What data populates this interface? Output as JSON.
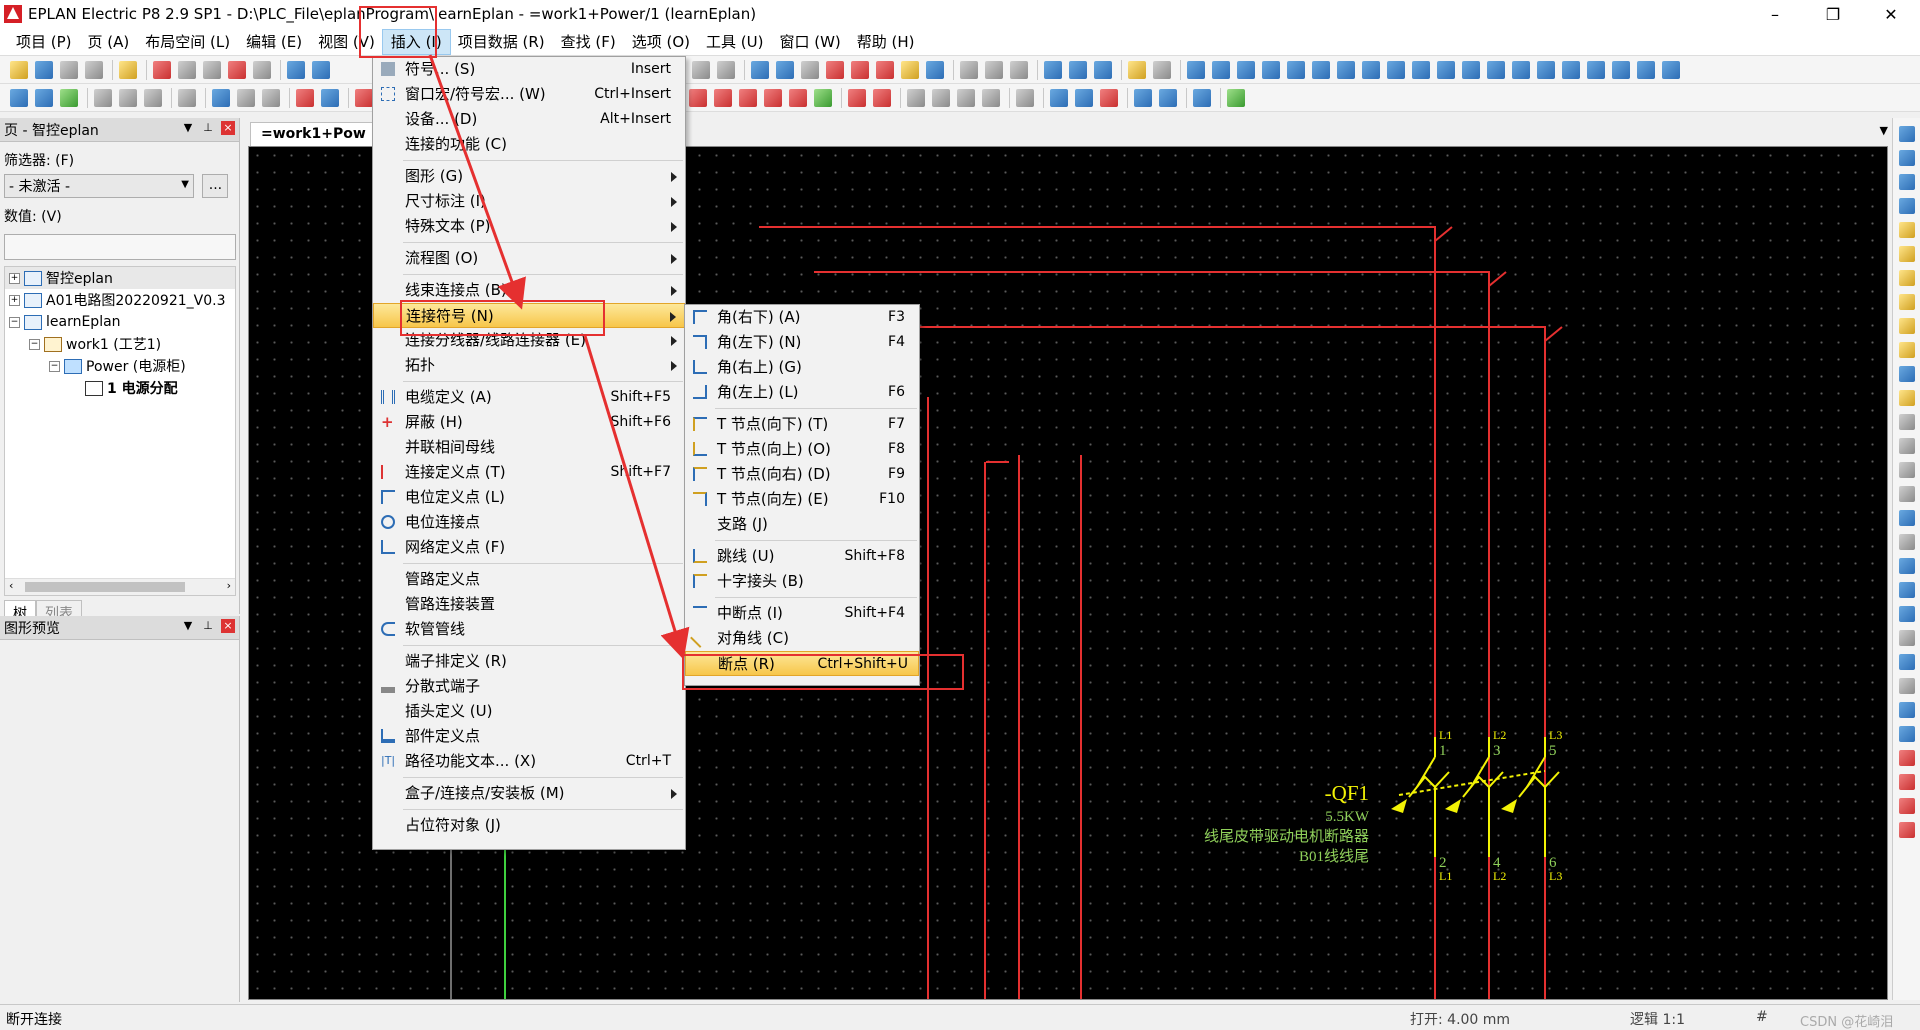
{
  "window": {
    "title": "EPLAN Electric P8 2.9 SP1 - D:\\PLC_File\\eplanProgram\\learnEplan - =work1+Power/1 (learnEplan)",
    "minimize": "–",
    "maximize": "❐",
    "close": "✕"
  },
  "menubar": {
    "items": [
      "项目 (P)",
      "页 (A)",
      "布局空间 (L)",
      "编辑 (E)",
      "视图 (V)",
      "插入 (I)",
      "项目数据 (R)",
      "查找 (F)",
      "选项 (O)",
      "工具 (U)",
      "窗口 (W)",
      "帮助 (H)"
    ]
  },
  "page_panel": {
    "title": "页 - 智控eplan",
    "filter_label": "筛选器: (F)",
    "filter_value": "- 未激活 -",
    "dots_button": "...",
    "value_label": "数值: (V)",
    "tree": [
      {
        "label": "智控eplan",
        "expander": "+"
      },
      {
        "label": "A01电路图20220921_V0.3",
        "expander": "+"
      },
      {
        "label": "learnEplan",
        "expander": "−"
      },
      {
        "label": "work1 (工艺1)",
        "expander": "−"
      },
      {
        "label": "Power (电源柜)",
        "expander": "−"
      },
      {
        "label": "1 电源分配",
        "expander": ""
      }
    ],
    "tabs": [
      "树",
      "列表"
    ]
  },
  "preview_panel": {
    "title": "图形预览"
  },
  "document_tab": {
    "label": "=work1+Pow"
  },
  "insert_menu": {
    "items": [
      {
        "label": "符号... (S)",
        "shortcut": "Insert",
        "submenu": false
      },
      {
        "label": "窗口宏/符号宏... (W)",
        "shortcut": "Ctrl+Insert",
        "submenu": false
      },
      {
        "label": "设备... (D)",
        "shortcut": "Alt+Insert",
        "submenu": false
      },
      {
        "label": "连接的功能 (C)",
        "shortcut": "",
        "submenu": false
      },
      {
        "label": "图形 (G)",
        "shortcut": "",
        "submenu": true
      },
      {
        "label": "尺寸标注 (I)",
        "shortcut": "",
        "submenu": true
      },
      {
        "label": "特殊文本 (P)",
        "shortcut": "",
        "submenu": true
      },
      {
        "label": "流程图 (O)",
        "shortcut": "",
        "submenu": true
      },
      {
        "label": "线束连接点 (B)",
        "shortcut": "",
        "submenu": true
      },
      {
        "label": "连接符号 (N)",
        "shortcut": "",
        "submenu": true
      },
      {
        "label": "连接分线器/线路连接器 (E)",
        "shortcut": "",
        "submenu": true
      },
      {
        "label": "拓扑",
        "shortcut": "",
        "submenu": true
      },
      {
        "label": "电缆定义 (A)",
        "shortcut": "Shift+F5",
        "submenu": false
      },
      {
        "label": "屏蔽 (H)",
        "shortcut": "Shift+F6",
        "submenu": false
      },
      {
        "label": "并联相间母线",
        "shortcut": "",
        "submenu": false
      },
      {
        "label": "连接定义点 (T)",
        "shortcut": "Shift+F7",
        "submenu": false
      },
      {
        "label": "电位定义点 (L)",
        "shortcut": "",
        "submenu": false
      },
      {
        "label": "电位连接点",
        "shortcut": "",
        "submenu": false
      },
      {
        "label": "网络定义点 (F)",
        "shortcut": "",
        "submenu": false
      },
      {
        "label": "管路定义点",
        "shortcut": "",
        "submenu": false
      },
      {
        "label": "管路连接装置",
        "shortcut": "",
        "submenu": false
      },
      {
        "label": "软管管线",
        "shortcut": "",
        "submenu": false
      },
      {
        "label": "端子排定义 (R)",
        "shortcut": "",
        "submenu": false
      },
      {
        "label": "分散式端子",
        "shortcut": "",
        "submenu": false
      },
      {
        "label": "插头定义 (U)",
        "shortcut": "",
        "submenu": false
      },
      {
        "label": "部件定义点",
        "shortcut": "",
        "submenu": false
      },
      {
        "label": "路径功能文本... (X)",
        "shortcut": "Ctrl+T",
        "submenu": false
      },
      {
        "label": "盒子/连接点/安装板 (M)",
        "shortcut": "",
        "submenu": true
      },
      {
        "label": "占位符对象 (J)",
        "shortcut": "",
        "submenu": false
      }
    ]
  },
  "connection_submenu": {
    "items": [
      {
        "label": "角(右下) (A)",
        "shortcut": "F3"
      },
      {
        "label": "角(左下) (N)",
        "shortcut": "F4"
      },
      {
        "label": "角(右上) (G)",
        "shortcut": ""
      },
      {
        "label": "角(左上) (L)",
        "shortcut": "F6"
      },
      {
        "label": "T 节点(向下) (T)",
        "shortcut": "F7"
      },
      {
        "label": "T 节点(向上) (O)",
        "shortcut": "F8"
      },
      {
        "label": "T 节点(向右) (D)",
        "shortcut": "F9"
      },
      {
        "label": "T 节点(向左) (E)",
        "shortcut": "F10"
      },
      {
        "label": "支路 (J)",
        "shortcut": ""
      },
      {
        "label": "跳线 (U)",
        "shortcut": "Shift+F8"
      },
      {
        "label": "十字接头 (B)",
        "shortcut": ""
      },
      {
        "label": "中断点 (I)",
        "shortcut": "Shift+F4"
      },
      {
        "label": "对角线 (C)",
        "shortcut": ""
      },
      {
        "label": "断点 (R)",
        "shortcut": "Ctrl+Shift+U"
      }
    ]
  },
  "schematic": {
    "device_tag": "-QF1",
    "power": "5.5KW",
    "description": "线尾皮带驱动电机断路器",
    "location": "B01线线尾",
    "phases_top": [
      "L1",
      "L2",
      "L3"
    ],
    "terminals_top": [
      "1",
      "3",
      "5"
    ],
    "terminals_bottom": [
      "2",
      "4",
      "6"
    ],
    "phases_bottom": [
      "L1",
      "L2",
      "L3"
    ]
  },
  "statusbar": {
    "left": "断开连接",
    "snap": "打开: 4.00 mm",
    "logic": "逻辑 1:1",
    "hash": "#",
    "watermark": "CSDN @花崎泪"
  },
  "colors": {
    "canvas_bg": "#000000",
    "wire_red": "#e53030",
    "symbol_yellow": "#f2f205",
    "text_green": "#8fd05a",
    "highlight": "#f7c64a",
    "annotation": "#e53030"
  }
}
